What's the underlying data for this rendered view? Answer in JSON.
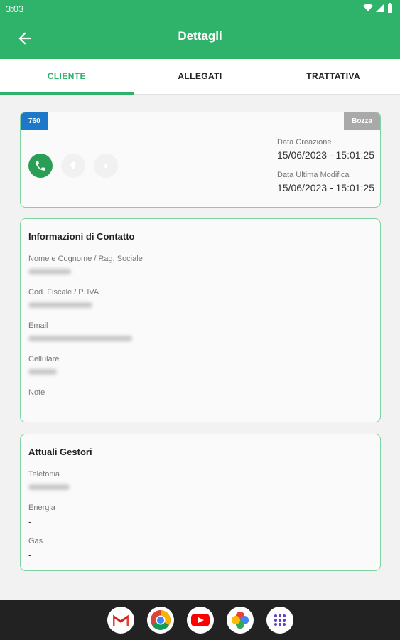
{
  "status_bar": {
    "time": "3:03"
  },
  "app_bar": {
    "title": "Dettagli"
  },
  "tabs": [
    {
      "label": "CLIENTE",
      "active": true
    },
    {
      "label": "ALLEGATI",
      "active": false
    },
    {
      "label": "TRATTATIVA",
      "active": false
    }
  ],
  "summary": {
    "id": "760",
    "status": "Bozza",
    "creation_label": "Data Creazione",
    "creation_value": "15/06/2023 - 15:01:25",
    "modified_label": "Data Ultima Modifica",
    "modified_value": "15/06/2023 - 15:01:25"
  },
  "contact": {
    "title": "Informazioni di Contatto",
    "name_label": "Nome e Cognome / Rag. Sociale",
    "tax_label": "Cod. Fiscale / P. IVA",
    "email_label": "Email",
    "mobile_label": "Cellulare",
    "notes_label": "Note",
    "notes_value": "-"
  },
  "providers": {
    "title": "Attuali Gestori",
    "phone_label": "Telefonia",
    "energy_label": "Energia",
    "energy_value": "-",
    "gas_label": "Gas",
    "gas_value": "-"
  },
  "colors": {
    "primary": "#2fb36b",
    "id_badge": "#1e78c9",
    "status_badge": "#a9a9a9"
  },
  "dock_apps": [
    "gmail-icon",
    "chrome-icon",
    "youtube-icon",
    "photos-icon",
    "app-drawer-icon"
  ]
}
